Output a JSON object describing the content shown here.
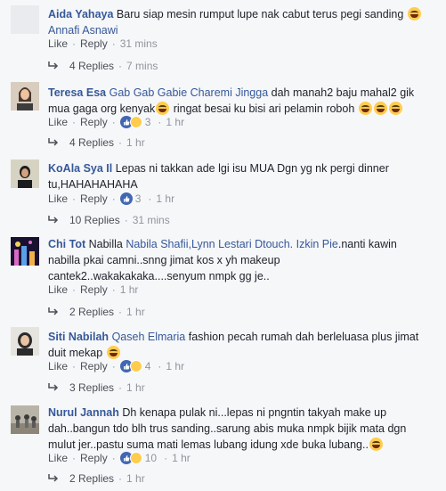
{
  "labels": {
    "like": "Like",
    "reply": "Reply",
    "separator": "·"
  },
  "comments": [
    {
      "author": "Aida Yahaya",
      "text": "Baru siap mesin rumput lupe nak cabut terus pegi sanding",
      "tag_after": "Annafi Asnawi",
      "time": "31 mins",
      "replies": "4 Replies",
      "replies_time": "7 mins"
    },
    {
      "author": "Teresa Esa",
      "tags": "Gab Gab Gabie Charemi Jingga",
      "text": "dah manah2 baju mahal2 gik mua gaga org kenyak",
      "text2": "ringat besai ku bisi ari pelamin roboh",
      "reactions": "3",
      "time": "1 hr",
      "replies": "4 Replies",
      "replies_time": "1 hr"
    },
    {
      "author": "KoAla Sya Il",
      "text": "Lepas ni takkan ade lgi isu MUA Dgn yg nk pergi dinner tu,HAHAHAHAHA",
      "reactions": "3",
      "time": "1 hr",
      "replies": "10 Replies",
      "replies_time": "31 mins"
    },
    {
      "author": "Chi Tot",
      "text_pre": "Nabilla",
      "tags": "Nabila Shafii,Lynn Lestari Dtouch. Izkin Pie",
      "text": ".nanti kawin nabilla pkai camni..snng jimat kos x yh makeup cantek2..wakakakaka....senyum nmpk gg je..",
      "time": "1 hr",
      "replies": "2 Replies",
      "replies_time": "1 hr"
    },
    {
      "author": "Siti Nabilah",
      "tags": "Qaseh Elmaria",
      "text": "fashion pecah rumah dah berleluasa plus jimat duit mekap",
      "reactions": "4",
      "time": "1 hr",
      "replies": "3 Replies",
      "replies_time": "1 hr"
    },
    {
      "author": "Nurul Jannah",
      "text": "Dh kenapa pulak ni...lepas ni pngntin takyah make up dah..bangun tdo blh trus sanding..sarung abis muka nmpk bijik mata dgn mulut jer..pastu suma mati lemas lubang idung xde buka lubang..",
      "reactions": "10",
      "time": "1 hr",
      "replies": "2 Replies",
      "replies_time": "1 hr"
    }
  ],
  "colors": {
    "link": "#365899",
    "meta": "#90949c",
    "like_blue": "#4267b2",
    "background": "#f6f7f9"
  }
}
